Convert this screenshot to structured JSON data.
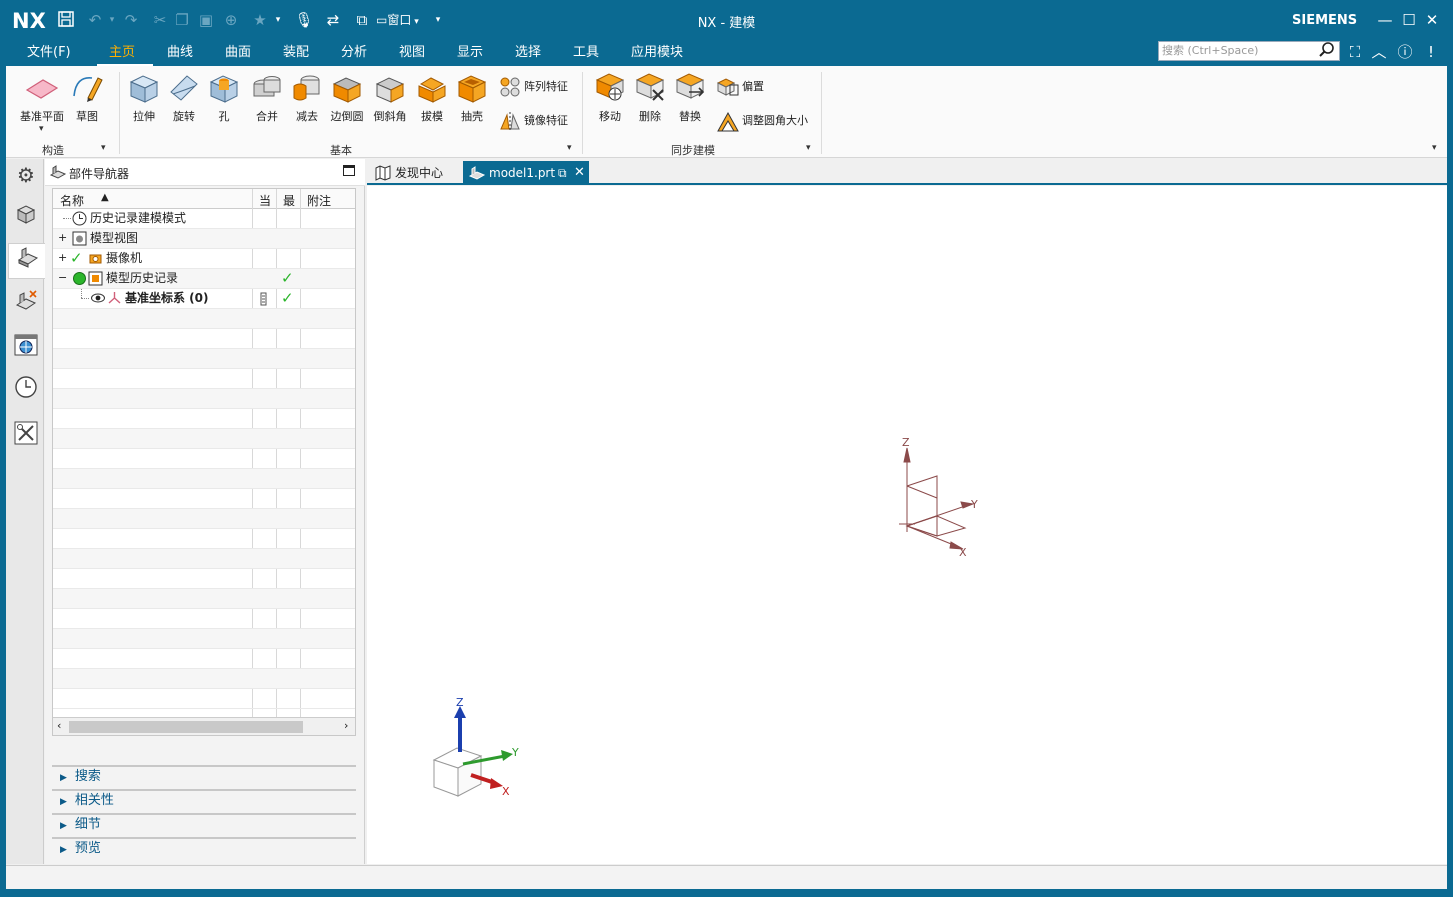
{
  "app": {
    "logo": "NX",
    "title": "NX - 建模",
    "brand": "SIEMENS",
    "accent_color": "#0b6a92",
    "active_color": "#ffb000"
  },
  "quick_access": {
    "window_label": "窗口",
    "icons": [
      "save-icon",
      "undo-icon",
      "redo-icon",
      "cut-icon",
      "copy-icon",
      "paste-icon",
      "repeat-icon",
      "favorite-icon",
      "voice-icon",
      "touch-mode-icon",
      "switch-window-icon",
      "window-icon"
    ]
  },
  "menu": {
    "items": [
      "文件(F)",
      "主页",
      "曲线",
      "曲面",
      "装配",
      "分析",
      "视图",
      "显示",
      "选择",
      "工具",
      "应用模块"
    ],
    "active": "主页",
    "search_placeholder": "搜索 (Ctrl+Space)"
  },
  "ribbon": {
    "groups": [
      {
        "label": "构造",
        "buttons": [
          "基准平面",
          "草图"
        ]
      },
      {
        "label": "基本",
        "buttons": [
          "拉伸",
          "旋转",
          "孔",
          "合并",
          "减去",
          "边倒圆",
          "倒斜角",
          "拔模",
          "抽壳"
        ],
        "small": [
          "阵列特征",
          "镜像特征"
        ]
      },
      {
        "label": "同步建模",
        "buttons": [
          "移动",
          "删除",
          "替换"
        ],
        "small": [
          "偏置",
          "调整圆角大小"
        ]
      }
    ]
  },
  "navigator": {
    "title": "部件导航器",
    "columns": [
      "名称",
      "当",
      "最",
      "附注"
    ],
    "rows": [
      {
        "name": "历史记录建模模式"
      },
      {
        "name": "模型视图"
      },
      {
        "name": "摄像机"
      },
      {
        "name": "模型历史记录"
      },
      {
        "name": "基准坐标系 (0)"
      }
    ],
    "sections": [
      "搜索",
      "相关性",
      "细节",
      "预览"
    ]
  },
  "tabs": [
    "发现中心",
    "model1.prt"
  ],
  "viewport": {
    "datum_axes": [
      "Z",
      "Y",
      "X"
    ],
    "triad_axes": [
      "Z",
      "Y",
      "X"
    ]
  }
}
